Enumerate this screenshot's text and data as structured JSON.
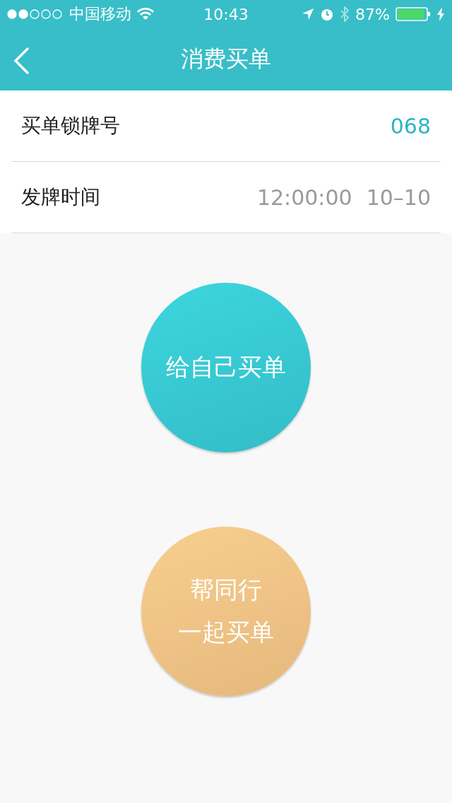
{
  "status_bar": {
    "carrier": "中国移动",
    "time": "10:43",
    "battery": "87%"
  },
  "nav": {
    "title": "消费买单"
  },
  "rows": [
    {
      "label": "买单锁牌号",
      "values": [
        "068"
      ],
      "kind": "accent"
    },
    {
      "label": "发牌时间",
      "values": [
        "12:00:00",
        "10–10"
      ],
      "kind": "muted"
    }
  ],
  "actions": [
    {
      "kind": "teal",
      "lines": [
        "给自己买单"
      ]
    },
    {
      "kind": "orange",
      "lines": [
        "帮同行",
        "一起买单"
      ]
    }
  ]
}
